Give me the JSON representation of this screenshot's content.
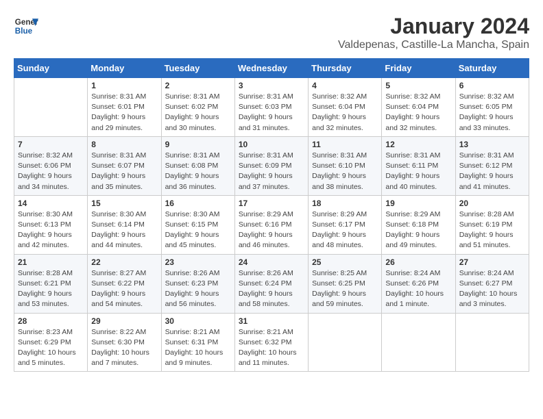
{
  "header": {
    "logo_general": "General",
    "logo_blue": "Blue",
    "title": "January 2024",
    "subtitle": "Valdepenas, Castille-La Mancha, Spain"
  },
  "days_of_week": [
    "Sunday",
    "Monday",
    "Tuesday",
    "Wednesday",
    "Thursday",
    "Friday",
    "Saturday"
  ],
  "weeks": [
    [
      {
        "num": "",
        "detail": ""
      },
      {
        "num": "1",
        "detail": "Sunrise: 8:31 AM\nSunset: 6:01 PM\nDaylight: 9 hours\nand 29 minutes."
      },
      {
        "num": "2",
        "detail": "Sunrise: 8:31 AM\nSunset: 6:02 PM\nDaylight: 9 hours\nand 30 minutes."
      },
      {
        "num": "3",
        "detail": "Sunrise: 8:31 AM\nSunset: 6:03 PM\nDaylight: 9 hours\nand 31 minutes."
      },
      {
        "num": "4",
        "detail": "Sunrise: 8:32 AM\nSunset: 6:04 PM\nDaylight: 9 hours\nand 32 minutes."
      },
      {
        "num": "5",
        "detail": "Sunrise: 8:32 AM\nSunset: 6:04 PM\nDaylight: 9 hours\nand 32 minutes."
      },
      {
        "num": "6",
        "detail": "Sunrise: 8:32 AM\nSunset: 6:05 PM\nDaylight: 9 hours\nand 33 minutes."
      }
    ],
    [
      {
        "num": "7",
        "detail": "Sunrise: 8:32 AM\nSunset: 6:06 PM\nDaylight: 9 hours\nand 34 minutes."
      },
      {
        "num": "8",
        "detail": "Sunrise: 8:31 AM\nSunset: 6:07 PM\nDaylight: 9 hours\nand 35 minutes."
      },
      {
        "num": "9",
        "detail": "Sunrise: 8:31 AM\nSunset: 6:08 PM\nDaylight: 9 hours\nand 36 minutes."
      },
      {
        "num": "10",
        "detail": "Sunrise: 8:31 AM\nSunset: 6:09 PM\nDaylight: 9 hours\nand 37 minutes."
      },
      {
        "num": "11",
        "detail": "Sunrise: 8:31 AM\nSunset: 6:10 PM\nDaylight: 9 hours\nand 38 minutes."
      },
      {
        "num": "12",
        "detail": "Sunrise: 8:31 AM\nSunset: 6:11 PM\nDaylight: 9 hours\nand 40 minutes."
      },
      {
        "num": "13",
        "detail": "Sunrise: 8:31 AM\nSunset: 6:12 PM\nDaylight: 9 hours\nand 41 minutes."
      }
    ],
    [
      {
        "num": "14",
        "detail": "Sunrise: 8:30 AM\nSunset: 6:13 PM\nDaylight: 9 hours\nand 42 minutes."
      },
      {
        "num": "15",
        "detail": "Sunrise: 8:30 AM\nSunset: 6:14 PM\nDaylight: 9 hours\nand 44 minutes."
      },
      {
        "num": "16",
        "detail": "Sunrise: 8:30 AM\nSunset: 6:15 PM\nDaylight: 9 hours\nand 45 minutes."
      },
      {
        "num": "17",
        "detail": "Sunrise: 8:29 AM\nSunset: 6:16 PM\nDaylight: 9 hours\nand 46 minutes."
      },
      {
        "num": "18",
        "detail": "Sunrise: 8:29 AM\nSunset: 6:17 PM\nDaylight: 9 hours\nand 48 minutes."
      },
      {
        "num": "19",
        "detail": "Sunrise: 8:29 AM\nSunset: 6:18 PM\nDaylight: 9 hours\nand 49 minutes."
      },
      {
        "num": "20",
        "detail": "Sunrise: 8:28 AM\nSunset: 6:19 PM\nDaylight: 9 hours\nand 51 minutes."
      }
    ],
    [
      {
        "num": "21",
        "detail": "Sunrise: 8:28 AM\nSunset: 6:21 PM\nDaylight: 9 hours\nand 53 minutes."
      },
      {
        "num": "22",
        "detail": "Sunrise: 8:27 AM\nSunset: 6:22 PM\nDaylight: 9 hours\nand 54 minutes."
      },
      {
        "num": "23",
        "detail": "Sunrise: 8:26 AM\nSunset: 6:23 PM\nDaylight: 9 hours\nand 56 minutes."
      },
      {
        "num": "24",
        "detail": "Sunrise: 8:26 AM\nSunset: 6:24 PM\nDaylight: 9 hours\nand 58 minutes."
      },
      {
        "num": "25",
        "detail": "Sunrise: 8:25 AM\nSunset: 6:25 PM\nDaylight: 9 hours\nand 59 minutes."
      },
      {
        "num": "26",
        "detail": "Sunrise: 8:24 AM\nSunset: 6:26 PM\nDaylight: 10 hours\nand 1 minute."
      },
      {
        "num": "27",
        "detail": "Sunrise: 8:24 AM\nSunset: 6:27 PM\nDaylight: 10 hours\nand 3 minutes."
      }
    ],
    [
      {
        "num": "28",
        "detail": "Sunrise: 8:23 AM\nSunset: 6:29 PM\nDaylight: 10 hours\nand 5 minutes."
      },
      {
        "num": "29",
        "detail": "Sunrise: 8:22 AM\nSunset: 6:30 PM\nDaylight: 10 hours\nand 7 minutes."
      },
      {
        "num": "30",
        "detail": "Sunrise: 8:21 AM\nSunset: 6:31 PM\nDaylight: 10 hours\nand 9 minutes."
      },
      {
        "num": "31",
        "detail": "Sunrise: 8:21 AM\nSunset: 6:32 PM\nDaylight: 10 hours\nand 11 minutes."
      },
      {
        "num": "",
        "detail": ""
      },
      {
        "num": "",
        "detail": ""
      },
      {
        "num": "",
        "detail": ""
      }
    ]
  ]
}
